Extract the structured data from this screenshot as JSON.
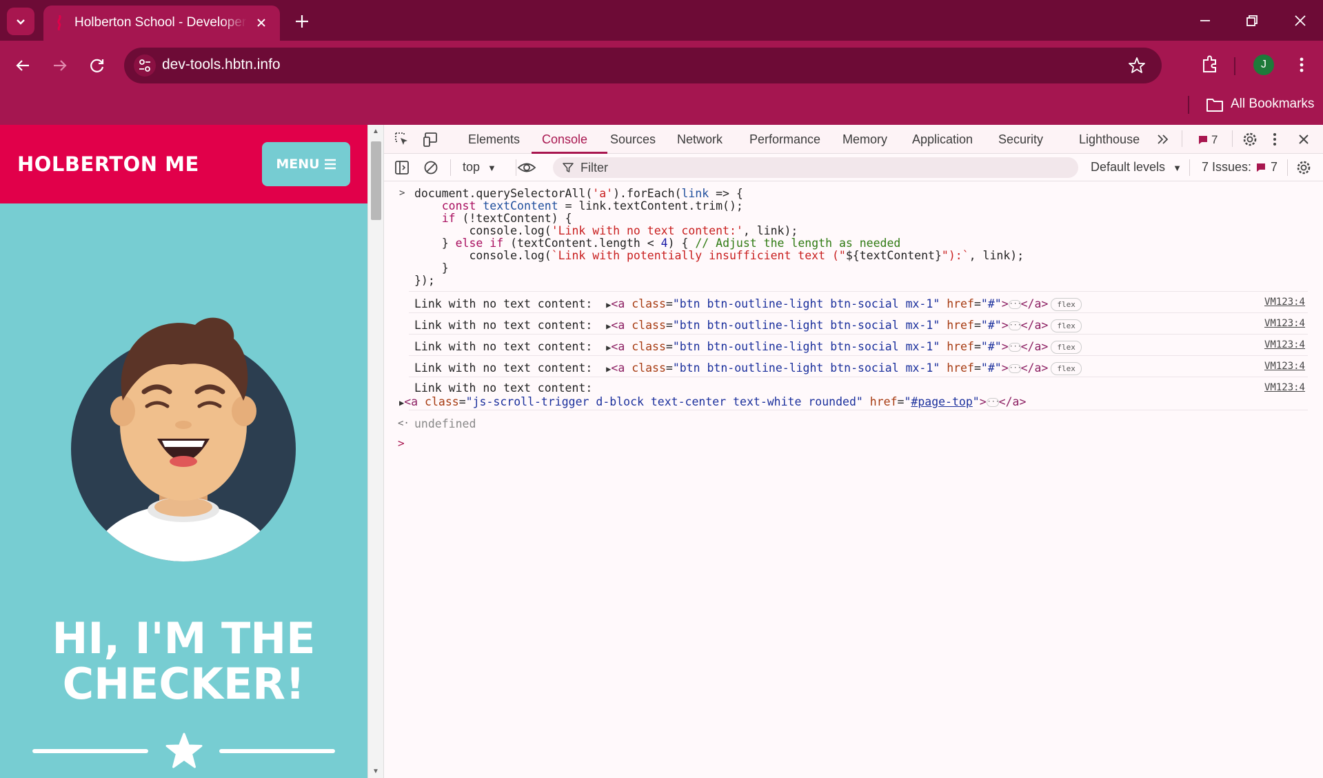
{
  "browser": {
    "tab_title": "Holberton School - Developer tools",
    "url": "dev-tools.hbtn.info",
    "profile_initial": "J",
    "bookmarks_label": "All Bookmarks"
  },
  "webpage": {
    "brand": "HOLBERTON ME",
    "menu_label": "MENU",
    "hero_line1": "HI, I'M THE",
    "hero_line2": "CHECKER!"
  },
  "devtools": {
    "tabs": [
      "Elements",
      "Console",
      "Sources",
      "Network",
      "Performance",
      "Memory",
      "Application",
      "Security",
      "Lighthouse"
    ],
    "active_tab": "Console",
    "messages_count": "7",
    "context": "top",
    "filter_placeholder": "Filter",
    "levels": "Default levels",
    "issues_label": "7 Issues:",
    "issues_count": "7",
    "code_lines": [
      "document.querySelectorAll('a').forEach(link => {",
      "    const textContent = link.textContent.trim();",
      "    if (!textContent) {",
      "        console.log('Link with no text content:', link);",
      "    } else if (textContent.length < 4) { // Adjust the length as needed",
      "        console.log(`Link with potentially insufficient text (\"${textContent}\"):`, link);",
      "    }",
      "});"
    ],
    "log_label": "Link with no text content:",
    "log_source": "VM123:4",
    "social_class": "btn btn-outline-light btn-social mx-1",
    "social_href": "#",
    "flex_badge": "flex",
    "scroll_class": "js-scroll-trigger d-block text-center text-white rounded",
    "scroll_href": "#page-top",
    "result": "undefined"
  }
}
